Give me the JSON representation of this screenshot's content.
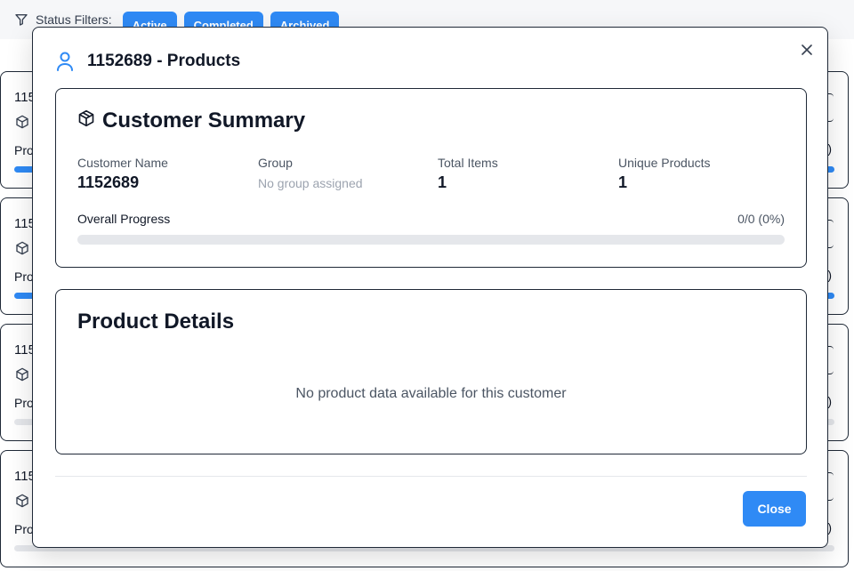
{
  "filters": {
    "label": "Status Filters:",
    "buttons": [
      "Active",
      "Completed",
      "Archived"
    ]
  },
  "background_cards": [
    {
      "id": "115",
      "progress_label": "Pro",
      "progress_fraction": 1.0,
      "right_text": ")"
    },
    {
      "id": "115",
      "progress_label": "Pro",
      "progress_fraction": 1.0,
      "right_text": ")"
    },
    {
      "id": "115",
      "progress_label": "Pro",
      "progress_fraction": 0.0,
      "right_text": ")"
    },
    {
      "id": "115",
      "progress_label": "Pro",
      "progress_fraction": 0.0,
      "right_text": ")"
    }
  ],
  "modal": {
    "title": "1152689 - Products",
    "close_icon": "close-icon",
    "summary": {
      "title": "Customer Summary",
      "customer_name_label": "Customer Name",
      "customer_name": "1152689",
      "group_label": "Group",
      "group_value": "No group assigned",
      "total_items_label": "Total Items",
      "total_items": "1",
      "unique_products_label": "Unique Products",
      "unique_products": "1",
      "progress_label": "Overall Progress",
      "progress_value": "0/0 (0%)",
      "progress_fraction": 0
    },
    "details": {
      "title": "Product Details",
      "empty_message": "No product data available for this customer"
    },
    "close_button": "Close"
  },
  "colors": {
    "accent": "#2f8af5",
    "track": "#e5e7eb",
    "border": "#1f2937"
  }
}
